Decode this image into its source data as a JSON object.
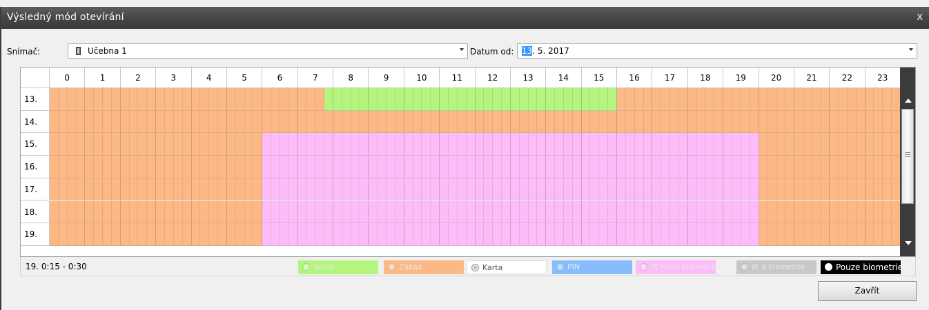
{
  "window": {
    "title": "Výsledný mód otevírání",
    "close_glyph": "x"
  },
  "form": {
    "sensor_label": "Snímač:",
    "sensor_value": "Učebna 1",
    "date_label": "Datum od:",
    "date_day_selected": "13",
    "date_rest": ". 5. 2017"
  },
  "grid": {
    "hours": [
      "0",
      "1",
      "2",
      "3",
      "4",
      "5",
      "6",
      "7",
      "8",
      "9",
      "10",
      "11",
      "12",
      "13",
      "14",
      "15",
      "16",
      "17",
      "18",
      "19",
      "20",
      "21",
      "22",
      "23"
    ],
    "slots_per_hour": 4,
    "rows": [
      {
        "label": "13.",
        "segments": [
          {
            "mode": "zakaz",
            "from": 0,
            "to": 7.75
          },
          {
            "mode": "volno",
            "from": 7.75,
            "to": 16
          },
          {
            "mode": "zakaz",
            "from": 16,
            "to": 24
          }
        ]
      },
      {
        "label": "14.",
        "segments": [
          {
            "mode": "zakaz",
            "from": 0,
            "to": 24
          }
        ]
      },
      {
        "label": "15.",
        "segments": [
          {
            "mode": "zakaz",
            "from": 0,
            "to": 6
          },
          {
            "mode": "ik_nebo_bio",
            "from": 6,
            "to": 20
          },
          {
            "mode": "zakaz",
            "from": 20,
            "to": 24
          }
        ]
      },
      {
        "label": "16.",
        "segments": [
          {
            "mode": "zakaz",
            "from": 0,
            "to": 6
          },
          {
            "mode": "ik_nebo_bio",
            "from": 6,
            "to": 20
          },
          {
            "mode": "zakaz",
            "from": 20,
            "to": 24
          }
        ]
      },
      {
        "label": "17.",
        "segments": [
          {
            "mode": "zakaz",
            "from": 0,
            "to": 6
          },
          {
            "mode": "ik_nebo_bio",
            "from": 6,
            "to": 20
          },
          {
            "mode": "zakaz",
            "from": 20,
            "to": 24
          }
        ]
      },
      {
        "label": "18.",
        "segments": [
          {
            "mode": "zakaz",
            "from": 0,
            "to": 6
          },
          {
            "mode": "ik_nebo_bio",
            "from": 6,
            "to": 20
          },
          {
            "mode": "zakaz",
            "from": 20,
            "to": 24
          }
        ]
      },
      {
        "label": "19.",
        "segments": [
          {
            "mode": "zakaz",
            "from": 0,
            "to": 6
          },
          {
            "mode": "ik_nebo_bio",
            "from": 6,
            "to": 20
          },
          {
            "mode": "zakaz",
            "from": 20,
            "to": 24
          }
        ]
      }
    ]
  },
  "status_text": "19. 0:15 - 0:30",
  "legend": [
    {
      "key": "volno",
      "label": "Volno",
      "color": "#b3f57f"
    },
    {
      "key": "zakaz",
      "label": "Zákaz",
      "color": "#fdb985"
    },
    {
      "key": "karta",
      "label": "Karta",
      "color": "#ffffff"
    },
    {
      "key": "pin",
      "label": "PIN",
      "color": "#87bdfd"
    },
    {
      "key": "ik_nebo_bio",
      "label": "IK nebo biometrie",
      "color": "#fcbcf9"
    },
    {
      "key": "ik_a_bio",
      "label": "IK a biometrie",
      "color": "#c8c8c8"
    },
    {
      "key": "pouze_bio",
      "label": "Pouze biometrie",
      "color": "#000000"
    }
  ],
  "buttons": {
    "close_label": "Zavřít"
  }
}
